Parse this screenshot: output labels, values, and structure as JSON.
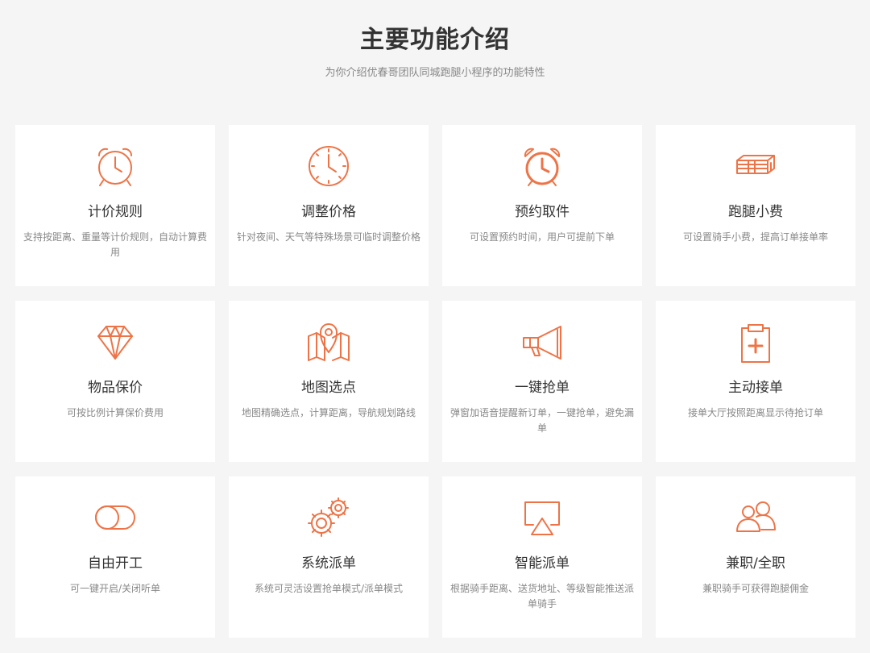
{
  "header": {
    "title": "主要功能介绍",
    "subtitle": "为你介绍优春哥团队同城跑腿小程序的功能特性"
  },
  "theme": {
    "accent": "#ee7447",
    "card_bg": "#ffffff",
    "page_bg": "#f5f5f6"
  },
  "features": [
    {
      "icon": "alarm-clock-icon",
      "title": "计价规则",
      "desc": "支持按距离、重量等计价规则，自动计算费用"
    },
    {
      "icon": "clock-icon",
      "title": "调整价格",
      "desc": "针对夜间、天气等特殊场景可临时调整价格"
    },
    {
      "icon": "alarm-clock-icon",
      "title": "预约取件",
      "desc": "可设置预约时间，用户可提前下单"
    },
    {
      "icon": "money-stack-icon",
      "title": "跑腿小费",
      "desc": "可设置骑手小费，提高订单接单率"
    },
    {
      "icon": "diamond-icon",
      "title": "物品保价",
      "desc": "可按比例计算保价费用"
    },
    {
      "icon": "map-pin-icon",
      "title": "地图选点",
      "desc": "地图精确选点，计算距离，导航规划路线"
    },
    {
      "icon": "megaphone-icon",
      "title": "一键抢单",
      "desc": "弹窗加语音提醒新订单，一键抢单，避免漏单"
    },
    {
      "icon": "clipboard-plus-icon",
      "title": "主动接单",
      "desc": "接单大厅按照距离显示待抢订单"
    },
    {
      "icon": "toggle-icon",
      "title": "自由开工",
      "desc": "可一键开启/关闭听单"
    },
    {
      "icon": "gears-icon",
      "title": "系统派单",
      "desc": "系统可灵活设置抢单模式/派单模式"
    },
    {
      "icon": "airplay-screen-icon",
      "title": "智能派单",
      "desc": "根据骑手距离、送货地址、等级智能推送派单骑手"
    },
    {
      "icon": "users-icon",
      "title": "兼职/全职",
      "desc": "兼职骑手可获得跑腿佣金"
    }
  ]
}
